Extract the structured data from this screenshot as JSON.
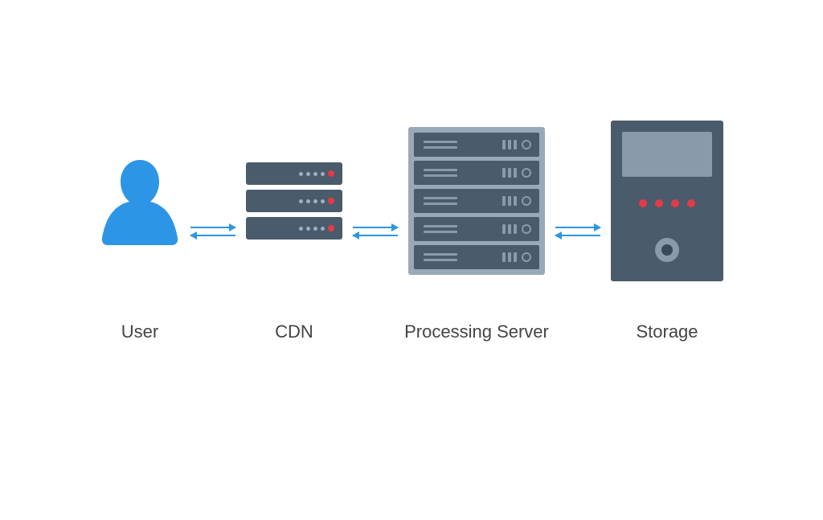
{
  "nodes": {
    "user": {
      "label": "User"
    },
    "cdn": {
      "label": "CDN"
    },
    "server": {
      "label": "Processing Server"
    },
    "storage": {
      "label": "Storage"
    }
  },
  "colors": {
    "user_fill": "#2d95e5",
    "device_body": "#4a5b6c",
    "device_light": "#8a9aaa",
    "chassis_bg": "#9aa9b8",
    "led_red": "#e63946",
    "arrow": "#2d95e5",
    "label_text": "#444444"
  },
  "icons": {
    "user": "user-silhouette-icon",
    "cdn": "server-stack-icon",
    "server": "rack-server-icon",
    "storage": "storage-tower-icon"
  }
}
